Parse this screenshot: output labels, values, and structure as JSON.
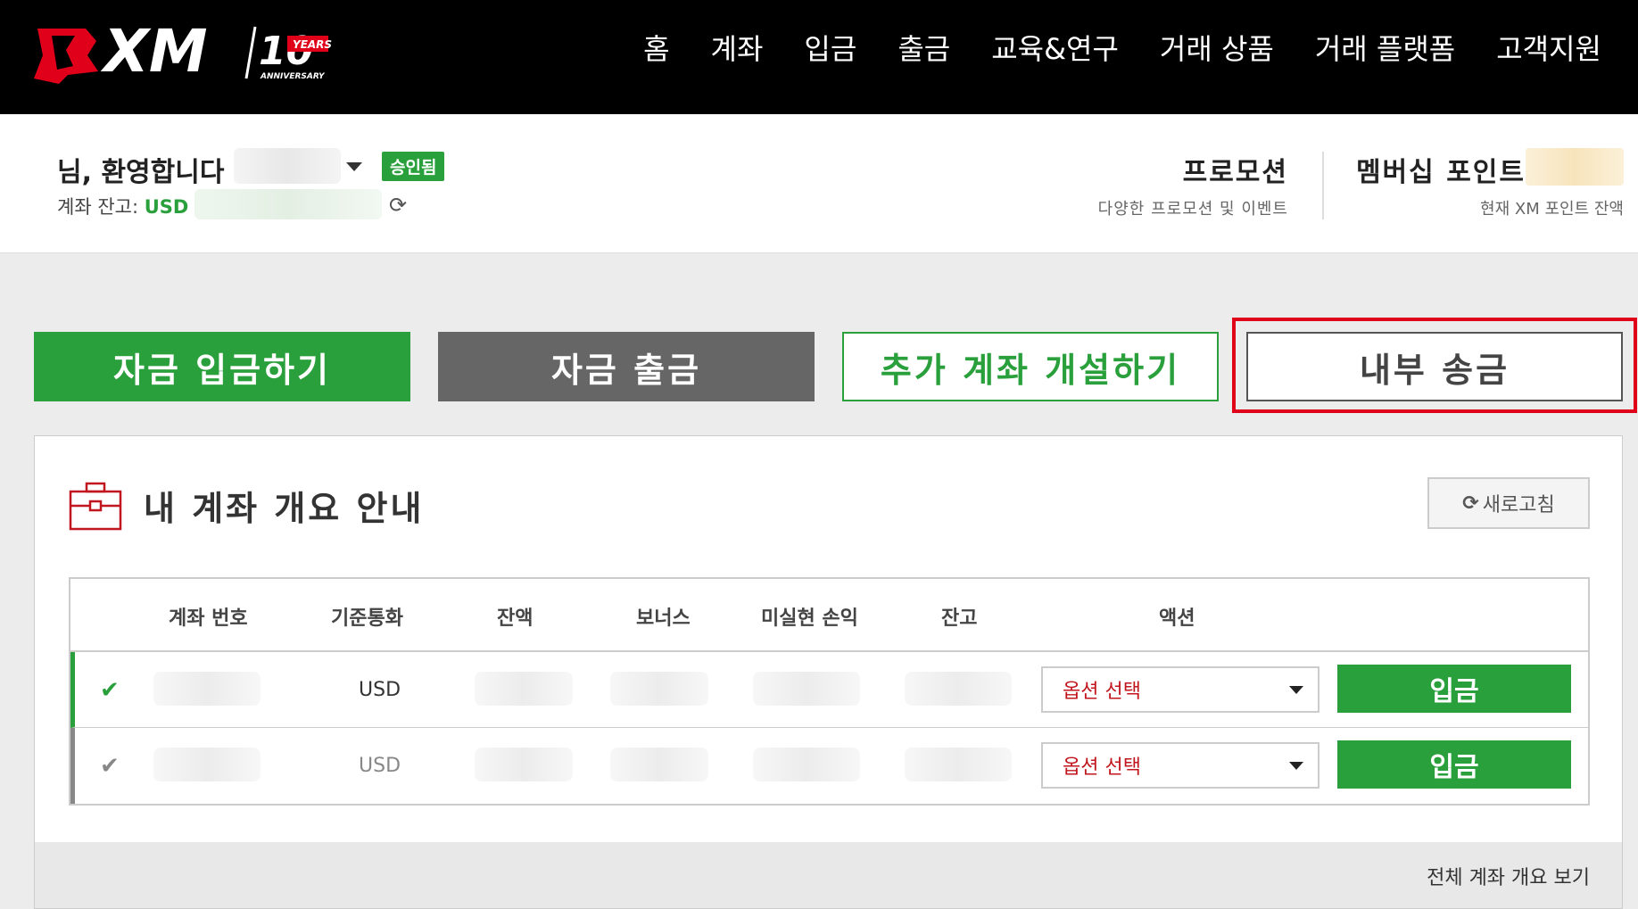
{
  "brand": {
    "logo_text": "XM",
    "anniversary_number": "10",
    "anniversary_years": "YEARS",
    "anniversary_label": "ANNIVERSARY",
    "accent": "#e0001a"
  },
  "nav": {
    "items": [
      "홈",
      "계좌",
      "입금",
      "출금",
      "교육&연구",
      "거래 상품",
      "거래 플랫폼",
      "고객지원"
    ]
  },
  "header": {
    "greeting": "님, 환영합니다",
    "status_badge": "승인됨",
    "balance_label": "계좌 잔고: ",
    "balance_currency": "USD",
    "refresh_icon": "refresh-icon"
  },
  "promotion": {
    "title": "프로모션",
    "subtitle": "다양한 프로모션 및 이벤트"
  },
  "membership": {
    "title": "멤버십 포인트",
    "subtitle": "현재 XM 포인트 잔액"
  },
  "actions": {
    "deposit": "자금 입금하기",
    "withdraw": "자금 출금",
    "open_account": "추가 계좌 개설하기",
    "internal_transfer": "내부 송금"
  },
  "overview": {
    "title": "내 계좌 개요 안내",
    "refresh_label": "새로고침",
    "columns": [
      "계좌 번호",
      "기준통화",
      "잔액",
      "보너스",
      "미실현 손익",
      "잔고",
      "액션"
    ],
    "rows": [
      {
        "currency": "USD",
        "select_label": "옵션 선택",
        "deposit_label": "입금"
      },
      {
        "currency": "USD",
        "select_label": "옵션 선택",
        "deposit_label": "입금"
      }
    ],
    "view_all": "전체 계좌 개요 보기"
  },
  "colors": {
    "green": "#2aa03c",
    "grey_button": "#666666",
    "select_text": "#c2161e"
  }
}
